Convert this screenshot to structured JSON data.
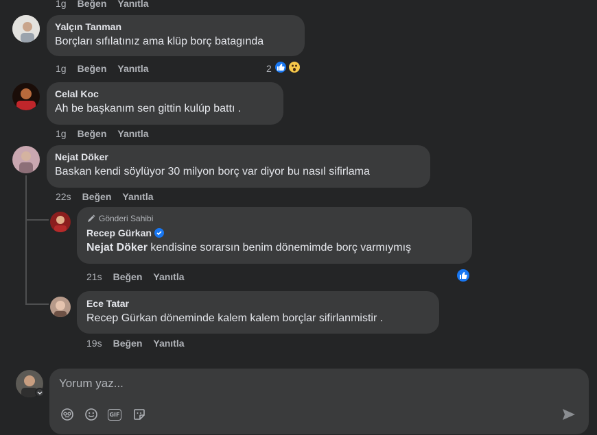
{
  "top_meta": {
    "time": "1g",
    "like": "Beğen",
    "reply": "Yanıtla"
  },
  "comments": [
    {
      "author": "Yalçın Tanman",
      "text": "Borçları sıfılatınız ama klüp borç batagında",
      "time": "1g",
      "like": "Beğen",
      "reply": "Yanıtla",
      "reaction_count": "2"
    },
    {
      "author": "Celal Koc",
      "text": "Ah be başkanım sen gittin kulúp battı .",
      "time": "1g",
      "like": "Beğen",
      "reply": "Yanıtla"
    },
    {
      "author": "Nejat Döker",
      "text": "Baskan kendi söylüyor 30 milyon borç var diyor bu nasıl sifirlama",
      "time": "22s",
      "like": "Beğen",
      "reply": "Yanıtla"
    }
  ],
  "replies": [
    {
      "badge": "Gönderi Sahibi",
      "author": "Recep Gürkan",
      "mention": "Nejat Döker",
      "text": " kendisine sorarsın benim dönemimde borç varmıymış",
      "time": "21s",
      "like": "Beğen",
      "reply": "Yanıtla"
    },
    {
      "author": "Ece Tatar",
      "text": "Recep Gürkan döneminde kalem kalem borçlar sifirlanmistir .",
      "time": "19s",
      "like": "Beğen",
      "reply": "Yanıtla"
    }
  ],
  "composer": {
    "placeholder": "Yorum yaz...",
    "gif_label": "GIF"
  },
  "colors": {
    "background": "#242526",
    "bubble": "#3a3b3c",
    "like_blue": "#1877f2",
    "muted_text": "#b0b3b8"
  }
}
